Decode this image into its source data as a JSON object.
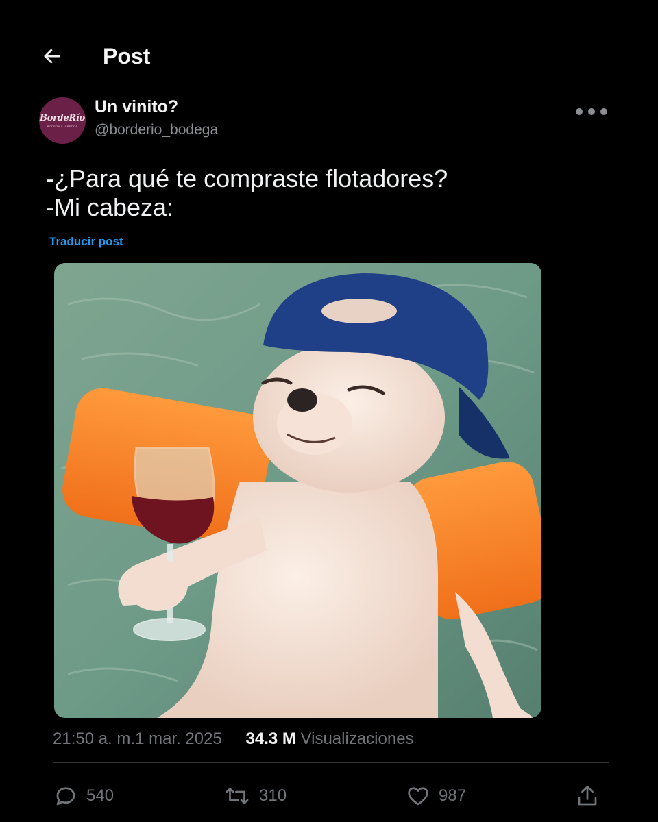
{
  "header": {
    "title": "Post",
    "back_icon": "arrow-left-icon"
  },
  "author": {
    "display_name": "Un vinito?",
    "handle": "@borderio_bodega",
    "avatar_logo_text": "BordeRío",
    "avatar_logo_subtext": "BODEGA & VIÑEDOS",
    "avatar_color": "#6b2147"
  },
  "post": {
    "lines": [
      "-¿Para qué te compraste flotadores?",
      "-Mi cabeza:"
    ],
    "translate_label": "Traducir post",
    "media_alt": "Chihuahua floating in water wearing blue cap and orange armbands, holding a glass of red wine"
  },
  "meta": {
    "timestamp": "21:50 a. m.1 mar. 2025",
    "views_count": "34.3 M",
    "views_label": "Visualizaciones"
  },
  "actions": {
    "replies": "540",
    "reposts": "310",
    "likes": "987"
  },
  "colors": {
    "accent": "#1d9bf0",
    "background": "#000000",
    "muted": "#71767b"
  }
}
